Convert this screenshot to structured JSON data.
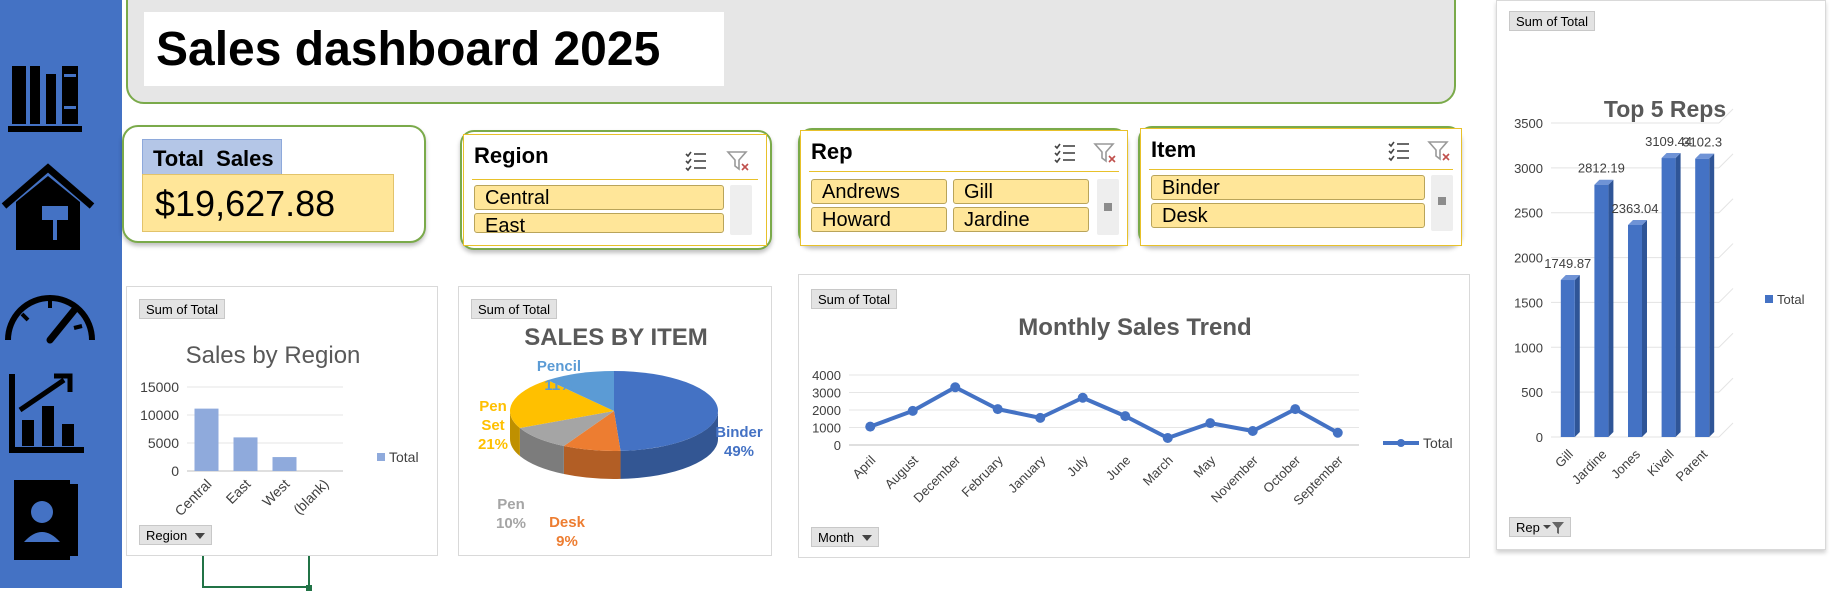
{
  "header": {
    "title": "Sales dashboard 2025"
  },
  "total_sales": {
    "label": "Total  Sales",
    "value": "$19,627.88"
  },
  "slicers": {
    "region": {
      "title": "Region",
      "items": [
        "Central",
        "East"
      ]
    },
    "rep": {
      "title": "Rep",
      "items": [
        "Andrews",
        "Gill",
        "Howard",
        "Jardine"
      ]
    },
    "item": {
      "title": "Item",
      "items": [
        "Binder",
        "Desk"
      ]
    }
  },
  "nav_icons": [
    "library-icon",
    "home-icon",
    "speedometer-icon",
    "chart-growth-icon",
    "contact-book-icon"
  ],
  "colors": {
    "sidebar": "#4472c4",
    "accent_green": "#7aaa4a",
    "slicer_item": "#ffe699",
    "series_blue": "#4472c4"
  },
  "charts": {
    "region": {
      "field_label": "Sum of Total",
      "axis_field": "Region"
    },
    "item": {
      "field_label": "Sum of Total"
    },
    "trend": {
      "field_label": "Sum of Total",
      "axis_field": "Month"
    },
    "reps": {
      "field_label": "Sum of Total",
      "axis_field": "Rep"
    }
  },
  "chart_data": [
    {
      "type": "bar",
      "title": "Sales by Region",
      "categories": [
        "Central",
        "East",
        "West",
        "(blank)"
      ],
      "series": [
        {
          "name": "Total",
          "values": [
            11139,
            6002,
            2487,
            0
          ]
        }
      ],
      "yticks": [
        0,
        5000,
        10000,
        15000
      ],
      "ylim": [
        0,
        15000
      ],
      "legend": "right",
      "color": "#8faadc"
    },
    {
      "type": "pie",
      "title": "SALES BY ITEM",
      "slices": [
        {
          "label": "Binder",
          "value": 49,
          "display": "49%",
          "color": "#4472c4"
        },
        {
          "label": "Desk",
          "value": 9,
          "display": "9%",
          "color": "#ed7d31"
        },
        {
          "label": "Pen",
          "value": 10,
          "display": "10%",
          "color": "#a5a5a5"
        },
        {
          "label": "Pen Set",
          "value": 21,
          "display": "21%",
          "color": "#ffc000"
        },
        {
          "label": "Pencil",
          "value": 11,
          "display": "11%",
          "color": "#5b9bd5"
        }
      ]
    },
    {
      "type": "line",
      "title": "Monthly Sales Trend",
      "categories": [
        "April",
        "August",
        "December",
        "February",
        "January",
        "July",
        "June",
        "March",
        "May",
        "November",
        "October",
        "September"
      ],
      "series": [
        {
          "name": "Total",
          "values": [
            1050,
            1950,
            3300,
            2050,
            1550,
            2700,
            1650,
            400,
            1250,
            800,
            2050,
            700
          ]
        }
      ],
      "yticks": [
        0,
        1000,
        2000,
        3000,
        4000
      ],
      "ylim": [
        0,
        4000
      ],
      "legend": "right",
      "color": "#4472c4"
    },
    {
      "type": "bar",
      "title": "Top 5 Reps",
      "categories": [
        "Gill",
        "Jardine",
        "Jones",
        "Kivell",
        "Parent"
      ],
      "series": [
        {
          "name": "Total",
          "values": [
            1749.87,
            2812.19,
            2363.04,
            3109.44,
            3102.3
          ]
        }
      ],
      "data_labels": [
        "1749.87",
        "2812.19",
        "2363.04",
        "3109.44",
        "3102.3"
      ],
      "yticks": [
        0,
        500,
        1000,
        1500,
        2000,
        2500,
        3000,
        3500
      ],
      "ylim": [
        0,
        3500
      ],
      "legend": "right",
      "color": "#4472c4"
    }
  ]
}
